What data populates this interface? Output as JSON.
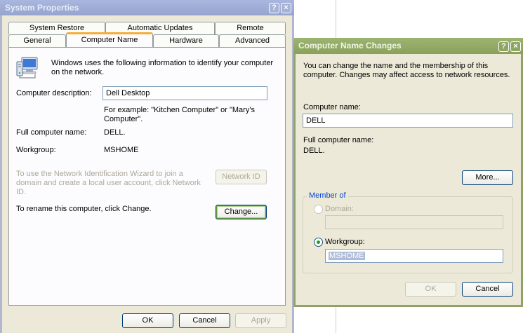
{
  "system_properties": {
    "title": "System Properties",
    "tabs_back": [
      "System Restore",
      "Automatic Updates",
      "Remote"
    ],
    "tabs_front": [
      "General",
      "Computer Name",
      "Hardware",
      "Advanced"
    ],
    "info_text": "Windows uses the following information to identify your computer on the network.",
    "computer_description_label": "Computer description:",
    "computer_description_value": "Dell Desktop",
    "example_text": "For example: \"Kitchen Computer\" or \"Mary's Computer\".",
    "full_name_label": "Full computer name:",
    "full_name_value": "DELL.",
    "workgroup_label": "Workgroup:",
    "workgroup_value": "MSHOME",
    "wizard_text": "To use the Network Identification Wizard to join a domain and create a local user account, click Network ID.",
    "network_id_button": "Network ID",
    "rename_text": "To rename this computer, click Change.",
    "change_button": "Change...",
    "ok_button": "OK",
    "cancel_button": "Cancel",
    "apply_button": "Apply",
    "help_glyph": "?",
    "close_glyph": "×"
  },
  "name_changes": {
    "title": "Computer Name Changes",
    "info_text": "You can change the name and the membership of this computer. Changes may affect access to network resources.",
    "computer_name_label": "Computer name:",
    "computer_name_value": "DELL",
    "full_name_label": "Full computer name:",
    "full_name_value": "DELL.",
    "more_button": "More...",
    "member_of_label": "Member of",
    "domain_label": "Domain:",
    "domain_value": "",
    "workgroup_label": "Workgroup:",
    "workgroup_value": "MSHOME",
    "domain_selected": false,
    "workgroup_selected": true,
    "ok_button": "OK",
    "cancel_button": "Cancel",
    "help_glyph": "?",
    "close_glyph": "×"
  }
}
